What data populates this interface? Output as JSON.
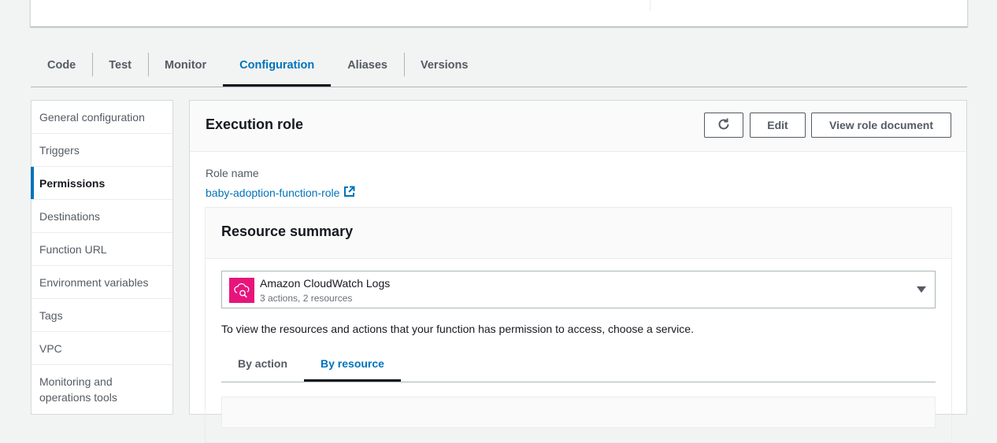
{
  "tabs": [
    {
      "label": "Code"
    },
    {
      "label": "Test"
    },
    {
      "label": "Monitor"
    },
    {
      "label": "Configuration"
    },
    {
      "label": "Aliases"
    },
    {
      "label": "Versions"
    }
  ],
  "active_tab": "Configuration",
  "sidebar": {
    "items": [
      {
        "label": "General configuration"
      },
      {
        "label": "Triggers"
      },
      {
        "label": "Permissions"
      },
      {
        "label": "Destinations"
      },
      {
        "label": "Function URL"
      },
      {
        "label": "Environment variables"
      },
      {
        "label": "Tags"
      },
      {
        "label": "VPC"
      },
      {
        "label": "Monitoring and operations tools"
      }
    ],
    "active": "Permissions"
  },
  "execution_role": {
    "title": "Execution role",
    "edit_label": "Edit",
    "view_label": "View role document",
    "role_name_label": "Role name",
    "role_name": "baby-adoption-function-role"
  },
  "resource_summary": {
    "title": "Resource summary",
    "service_name": "Amazon CloudWatch Logs",
    "service_desc": "3 actions, 2 resources",
    "hint": "To view the resources and actions that your function has permission to access, choose a service.",
    "subtabs": [
      {
        "label": "By action"
      },
      {
        "label": "By resource"
      }
    ],
    "active_subtab": "By resource"
  },
  "colors": {
    "accent": "#0073bb",
    "service_icon": "#e7157b",
    "background": "#f2f3f3"
  },
  "icons": {
    "refresh": "refresh-icon",
    "external": "external-link-icon",
    "service": "cloudwatch-logs-icon",
    "dropdown": "caret-down-icon"
  }
}
